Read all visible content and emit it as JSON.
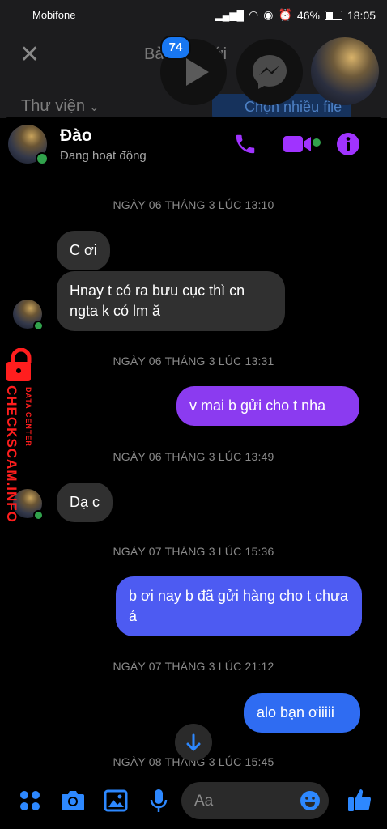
{
  "status_bar": {
    "carrier": "Mobifone",
    "battery": "46%",
    "time": "18:05"
  },
  "background_screen": {
    "title": "Bản tin mới",
    "library": "Thư viện",
    "select_multiple": "Chọn nhiều file",
    "badge_count": "74"
  },
  "contact": {
    "name": "Đào",
    "status": "Đang hoạt động"
  },
  "timestamps": {
    "t1": "NGÀY 06 THÁNG 3 LÚC 13:10",
    "t2": "NGÀY 06 THÁNG 3 LÚC 13:31",
    "t3": "NGÀY 06 THÁNG 3 LÚC 13:49",
    "t4": "NGÀY 07 THÁNG 3 LÚC 15:36",
    "t5": "NGÀY 07 THÁNG 3 LÚC 21:12",
    "t6": "NGÀY 08 THÁNG 3 LÚC 15:45"
  },
  "messages": {
    "m1": "C ơi",
    "m2": "Hnay t có ra bưu cục thì cn ngta k có lm ă",
    "m3": "v mai b gửi cho t nha",
    "m4": "Dạ c",
    "m5": "b ơi nay b đã gửi hàng cho t chưa á",
    "m6": "alo bạn ơiiiii"
  },
  "composer": {
    "placeholder": "Aa"
  },
  "watermark": {
    "line1": "DATA CENTER",
    "line2": "CHECKSCAM.INFO"
  },
  "colors": {
    "accent_purple": "#a033ff",
    "accent_blue": "#2d88ff",
    "outgoing_top": "#8a3cf2",
    "outgoing_bottom": "#2f6cf2",
    "incoming": "#303030",
    "online": "#31a24c"
  },
  "icons": [
    "close-icon",
    "play-icon",
    "messenger-icon",
    "phone-icon",
    "video-icon",
    "info-icon",
    "apps-icon",
    "camera-icon",
    "image-icon",
    "microphone-icon",
    "emoji-icon",
    "like-icon",
    "arrow-down-icon",
    "lock-icon"
  ]
}
